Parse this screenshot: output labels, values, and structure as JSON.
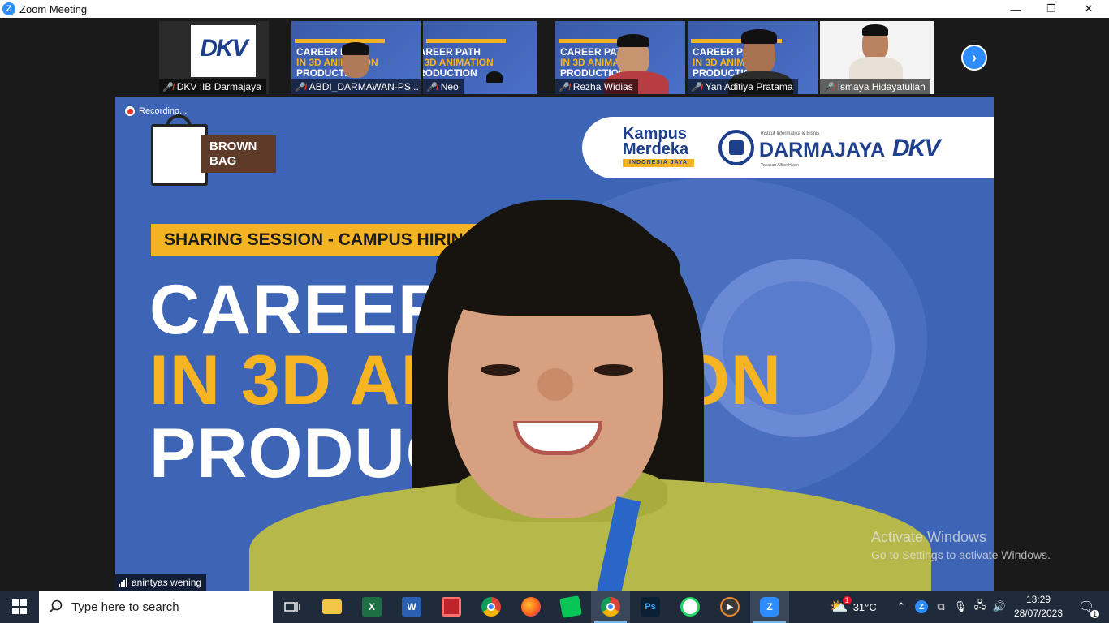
{
  "window": {
    "title": "Zoom Meeting",
    "minimize_glyph": "—",
    "restore_glyph": "❐",
    "close_glyph": "✕"
  },
  "participants": [
    {
      "name": "DKV IIB Darmajaya",
      "mic_muted": true,
      "logo_text": "DKV"
    },
    {
      "name": "ABDI_DARMAWAN-PS...",
      "mic_muted": true
    },
    {
      "name": "Neo",
      "mic_muted": true
    },
    {
      "name": "Rezha Widias",
      "mic_muted": true
    },
    {
      "name": "Yan Aditiya Pratama",
      "mic_muted": true
    },
    {
      "name": "Ismaya Hidayatullah",
      "mic_muted": true
    }
  ],
  "thumb_slide": {
    "line1": "CAREER PATH",
    "line2": "IN 3D ANIMATION",
    "line3": "PRODUCTION"
  },
  "main_video": {
    "recording_label": "Recording...",
    "speaker_name": "anintyas wening",
    "brand_line1": "BROWN",
    "brand_line2": "BAG",
    "kampus_line1": "Kampus",
    "kampus_line2": "Merdeka",
    "kampus_sub": "INDONESIA JAYA",
    "darmajaya_top": "Institut Informatika & Bisnis",
    "darmajaya_name": "DARMAJAYA",
    "darmajaya_sub": "Yayasan Alfian Husin",
    "dkv_logo": "DKV",
    "session_band": "SHARING SESSION - CAMPUS HIRING",
    "title_line1": "CAREER",
    "title_line2": "IN 3D AN",
    "title_line2b": "ON",
    "title_line3": "PRODUC"
  },
  "watermark": {
    "line1": "Activate Windows",
    "line2": "Go to Settings to activate Windows."
  },
  "taskbar": {
    "search_placeholder": "Type here to search",
    "weather": "31°C",
    "weather_badge": "1",
    "time": "13:29",
    "date": "28/07/2023",
    "notification_count": "1",
    "apps": [
      "task-view",
      "file-explorer",
      "excel",
      "word",
      "snipping-tool",
      "chrome",
      "firefox",
      "line",
      "chrome-2",
      "photoshop",
      "whatsapp",
      "media-player",
      "zoom"
    ]
  },
  "colors": {
    "zoom_blue": "#2d8cff",
    "slide_blue": "#3e64b6",
    "accent_yellow": "#f4b322",
    "mic_muted_red": "#ff3b30",
    "taskbar": "#1f2a3a"
  }
}
